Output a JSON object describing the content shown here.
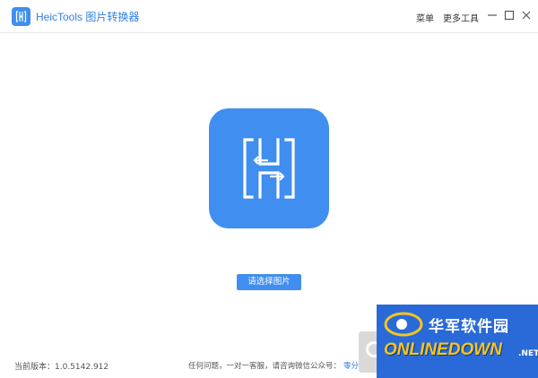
{
  "window": {
    "title": "HeicTools 图片转换器",
    "menu": [
      "菜单",
      "更多工具"
    ],
    "controls": [
      "minimize-icon",
      "maximize-icon",
      "close-icon"
    ]
  },
  "main": {
    "select_button": "请选择图片",
    "icon": "h-arrows-icon"
  },
  "footer": {
    "version": "当前版本：1.0.5142.912",
    "contact": "任何问题，一对一客服，请咨询微信公众号：",
    "contact_link": "零分猫"
  },
  "watermark": {
    "cn": "华军软件园",
    "en": "ONLINEDOWN",
    "suffix": ".NET"
  },
  "colors": {
    "accent": "#3f8ef0",
    "link": "#2f7fe4",
    "watermark_bg": "#2a6ad8",
    "watermark_text": "#f7c51c"
  }
}
